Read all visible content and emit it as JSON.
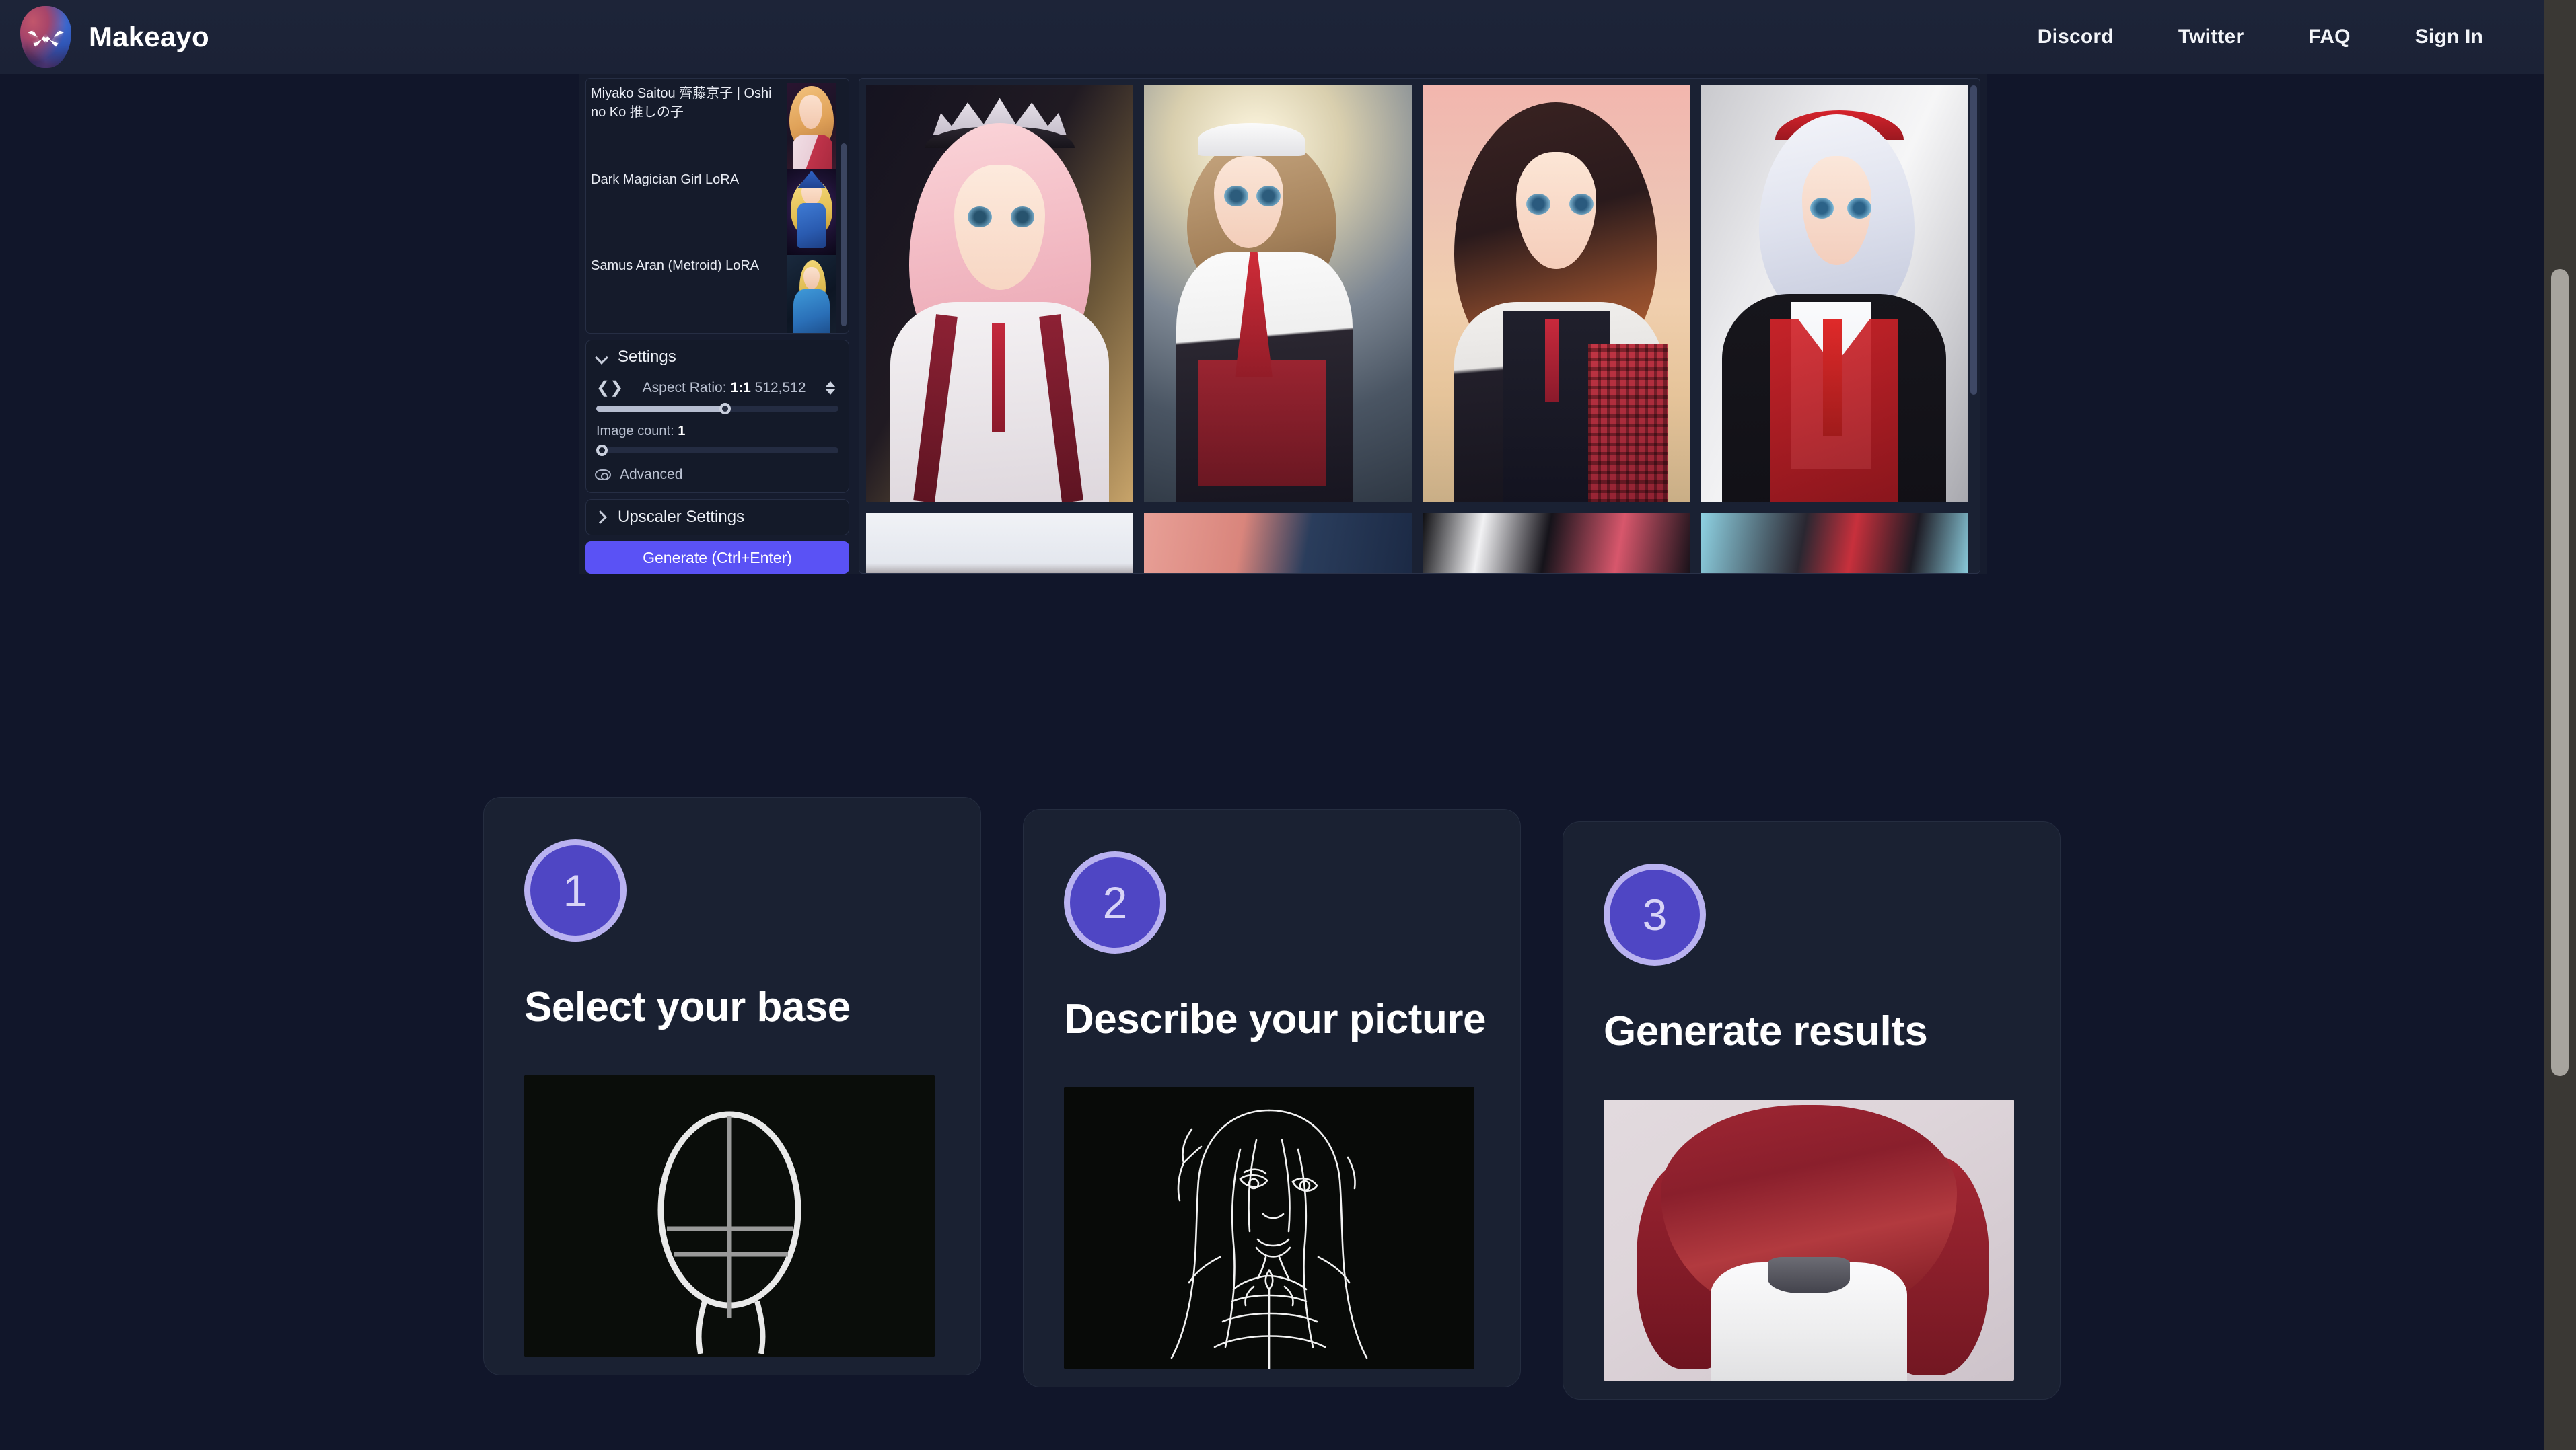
{
  "nav": {
    "brand": "Makeayo",
    "links": [
      {
        "label": "Discord"
      },
      {
        "label": "Twitter"
      },
      {
        "label": "FAQ"
      },
      {
        "label": "Sign In"
      }
    ]
  },
  "embed": {
    "lora_list": [
      {
        "title": "Miyako Saitou 齊藤京子 | Oshi no Ko 推しの子"
      },
      {
        "title": "Dark Magician Girl LoRA"
      },
      {
        "title": "Samus Aran (Metroid) LoRA"
      }
    ],
    "settings": {
      "title": "Settings",
      "aspect_ratio_label": "Aspect Ratio:",
      "aspect_ratio_value": "1:1",
      "aspect_ratio_dims": "512,512",
      "aspect_slider_percent": 53,
      "image_count_label": "Image count:",
      "image_count_value": "1",
      "image_count_slider_percent": 0,
      "advanced_label": "Advanced"
    },
    "upscaler": {
      "title": "Upscaler Settings"
    },
    "generate_button": "Generate (Ctrl+Enter)",
    "gallery": {
      "row1": [
        {
          "alt": "pink-haired girl with tiara and white blouse"
        },
        {
          "alt": "brown-haired maid with red ribbon by stained glass"
        },
        {
          "alt": "brunette in plaid school uniform at sunset"
        },
        {
          "alt": "silver-haired girl with red tie and fur jacket"
        }
      ],
      "row2": [
        {
          "alt": "pale portrait thumbnail"
        },
        {
          "alt": "pink figure on blue thumbnail"
        },
        {
          "alt": "dark high-contrast thumbnail"
        },
        {
          "alt": "cyan and red thumbnail"
        }
      ]
    }
  },
  "steps": [
    {
      "number": "1",
      "title": "Select your base",
      "thumb_alt": "head construction guideline sketch"
    },
    {
      "number": "2",
      "title": "Describe your picture",
      "thumb_alt": "white line art of anime girl on black"
    },
    {
      "number": "3",
      "title": "Generate results",
      "thumb_alt": "rendered red-haired anime girl portrait"
    }
  ],
  "colors": {
    "page_background": "#11162a",
    "card_background": "#1a2132",
    "accent_purple": "#5a52f5",
    "badge_fill": "#4f46c4",
    "badge_ring": "#b9b2f0"
  }
}
